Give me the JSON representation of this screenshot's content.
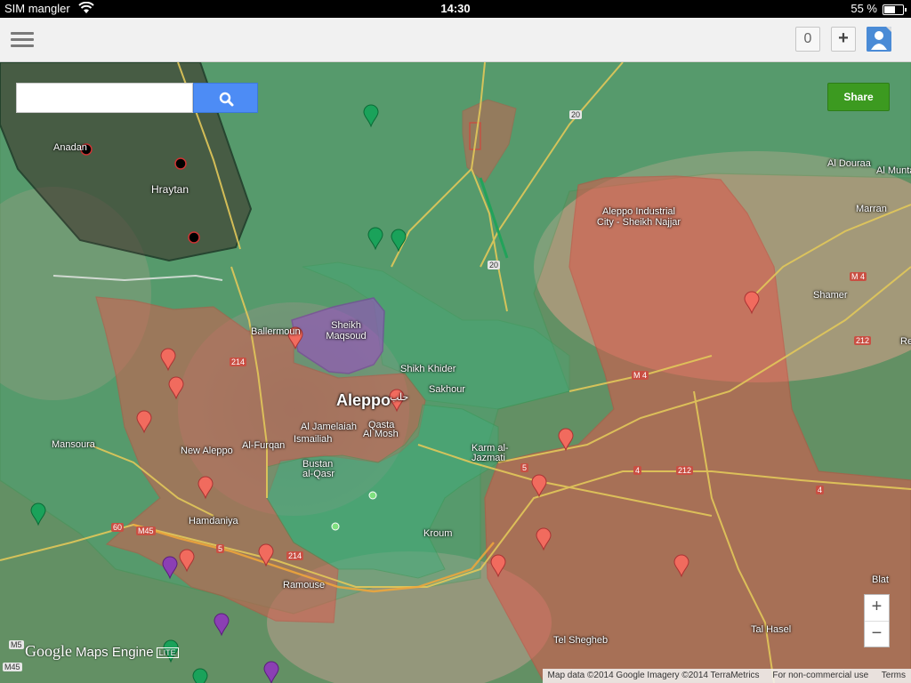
{
  "status_bar": {
    "carrier": "SIM mangler",
    "time": "14:30",
    "battery": "55 %",
    "battery_level": 0.55
  },
  "toolbar": {
    "count": "0",
    "add": "+"
  },
  "search": {
    "value": "",
    "placeholder": ""
  },
  "share_label": "Share",
  "zoom": {
    "in": "+",
    "out": "−"
  },
  "logo": {
    "google": "Google",
    "product": "Maps Engine",
    "badge": "LITE"
  },
  "attribution": {
    "data": "Map data ©2014 Google Imagery ©2014 TerraMetrics",
    "license": "For non-commercial use",
    "terms": "Terms"
  },
  "colors": {
    "government": "#e0574b",
    "rebel": "#3fae7c",
    "kurdish": "#9a4fc2",
    "isis": "#000000",
    "share": "#3c9a20",
    "search": "#4d8cf5"
  },
  "places": {
    "aleppo": "Aleppo",
    "aleppo_ar": "حلب",
    "industrial_city": "Aleppo Industrial City - Sheikh Najjar",
    "sheikh_maqsoud": "Sheikh Maqsoud",
    "hraytan": "Hraytan",
    "anadan": "Anadan",
    "ballermoun": "Ballermoun",
    "shikh_khider": "Shikh Khider",
    "sakhour": "Sakhour",
    "al_jamelaiah": "Al Jamelaiah",
    "ismailiah": "Ismailiah",
    "al_mosh": "Al Mosh",
    "qasta": "Qasta",
    "al_furqan": "Al-Furqan",
    "new_aleppo": "New Aleppo",
    "mansoura": "Mansoura",
    "bustan_al_qasr": "Bustan al-Qasr",
    "karm_al_jazmati": "Karm al-Jazmati",
    "hamdaniya": "Hamdaniya",
    "ramouse": "Ramouse",
    "kroum": "Kroum",
    "tel_shegheb": "Tel Shegheb",
    "tal_hasel": "Tal Hasel",
    "blat": "Blat",
    "shamer": "Shamer",
    "marran": "Marran",
    "al_douraa": "Al Douraa",
    "al_munta": "Al Munta",
    "re": "Re"
  },
  "roads": {
    "r20a": "20",
    "r20b": "20",
    "m4a": "M 4",
    "m4b": "M 4",
    "r212a": "212",
    "r212b": "212",
    "r4a": "4",
    "r4b": "4",
    "r5a": "5",
    "r5b": "5",
    "r60": "60",
    "m45a": "M45",
    "m45b": "M45",
    "m5": "M5",
    "r214a": "214",
    "r214b": "214"
  }
}
